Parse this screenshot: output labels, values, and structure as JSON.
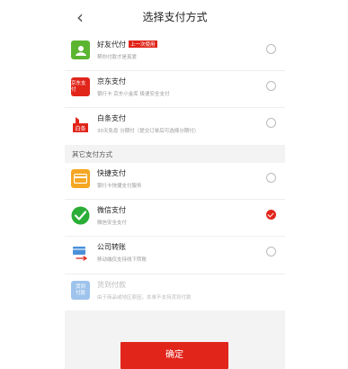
{
  "nav": {
    "back_icon": "chevron-left-icon",
    "title": "选择支付方式"
  },
  "methods_top": [
    {
      "id": "friend-pay",
      "name": "好友代付",
      "badge": "上一次使用",
      "desc": "帮你付款才是真爱",
      "icon": "friend-pay-icon",
      "icon_color": "#5cb531",
      "selected": false
    },
    {
      "id": "jd-pay",
      "name": "京东支付",
      "badge": "",
      "desc": "银行卡 京东小金库 极速安全支付",
      "icon": "jd-pay-icon",
      "icon_text": "京东支付",
      "icon_color": "#e1251b",
      "selected": false
    },
    {
      "id": "baitiao",
      "name": "白条支付",
      "badge": "",
      "desc": "30天免息 分期付（提交订单后可选择分期付）",
      "icon": "baitiao-icon",
      "icon_text": "白条",
      "icon_color": "#e1251b",
      "selected": false
    }
  ],
  "section_label": "其它支付方式",
  "methods_other": [
    {
      "id": "quick-pay",
      "name": "快捷支付",
      "desc": "银行卡快捷支付服务",
      "icon": "quick-pay-card-icon",
      "icon_color": "#f5a623",
      "selected": false,
      "disabled": false
    },
    {
      "id": "wechat-pay",
      "name": "微信支付",
      "desc": "微信安全支付",
      "icon": "wechat-icon",
      "icon_color": "#2aae37",
      "selected": true,
      "disabled": false
    },
    {
      "id": "transfer",
      "name": "公司转账",
      "desc": "移动端仅支持线下转账",
      "icon": "company-transfer-icon",
      "icon_color": "#4a90d9",
      "selected": false,
      "disabled": false
    },
    {
      "id": "cod",
      "name": "货到付款",
      "desc": "由于商品或地区原因，本单不支持货到付款",
      "icon": "cod-icon",
      "icon_text": "货到付款",
      "icon_color": "#9ec3ec",
      "selected": false,
      "disabled": true
    }
  ],
  "confirm_label": "确定",
  "accent_color": "#e1251b"
}
